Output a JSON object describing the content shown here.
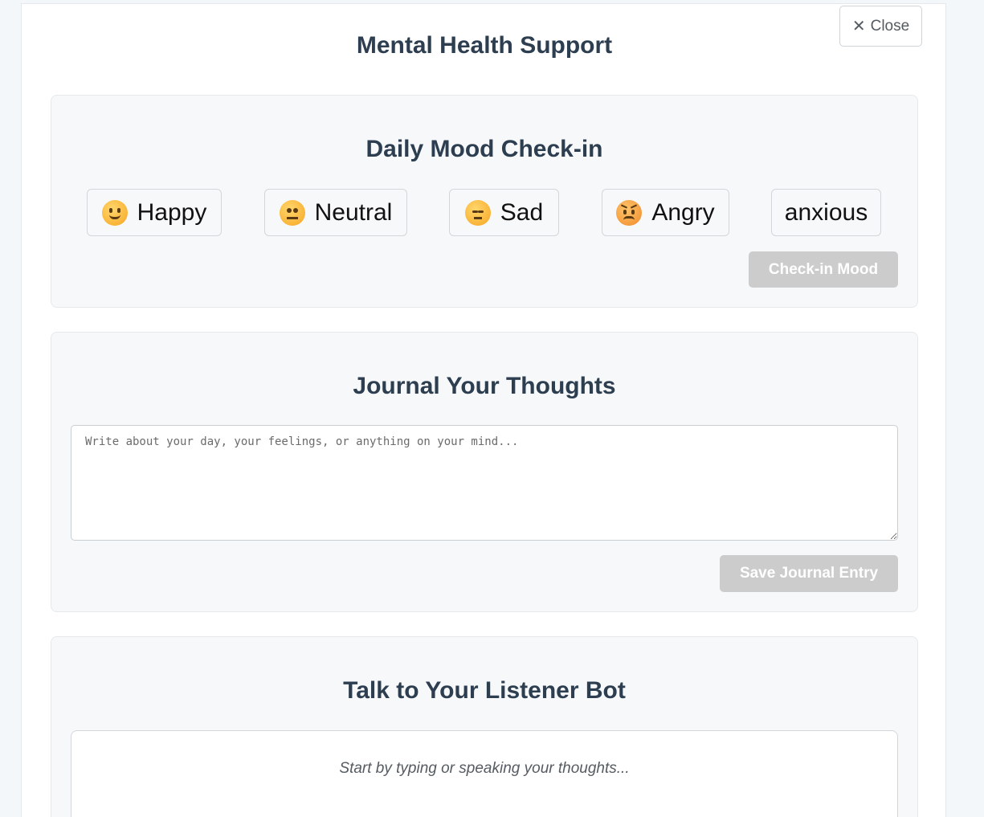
{
  "modal": {
    "title": "Mental Health Support",
    "close_icon": "✕",
    "close_label": "Close"
  },
  "mood": {
    "heading": "Daily Mood Check-in",
    "options": [
      {
        "icon": "smiling-face-icon",
        "label": "Happy"
      },
      {
        "icon": "neutral-face-icon",
        "label": "Neutral"
      },
      {
        "icon": "pensive-face-icon",
        "label": "Sad"
      },
      {
        "icon": "angry-face-icon",
        "label": "Angry"
      },
      {
        "icon": "",
        "label": "anxious"
      }
    ],
    "submit_label": "Check-in Mood"
  },
  "journal": {
    "heading": "Journal Your Thoughts",
    "placeholder": "Write about your day, your feelings, or anything on your mind...",
    "value": "",
    "save_label": "Save Journal Entry"
  },
  "listener": {
    "heading": "Talk to Your Listener Bot",
    "placeholder": "Start by typing or speaking your thoughts..."
  },
  "colors": {
    "heading": "#2c3e50",
    "card_bg": "#f7f8fa",
    "disabled_button": "#cccccc",
    "page_bg": "#f3f7fa"
  }
}
